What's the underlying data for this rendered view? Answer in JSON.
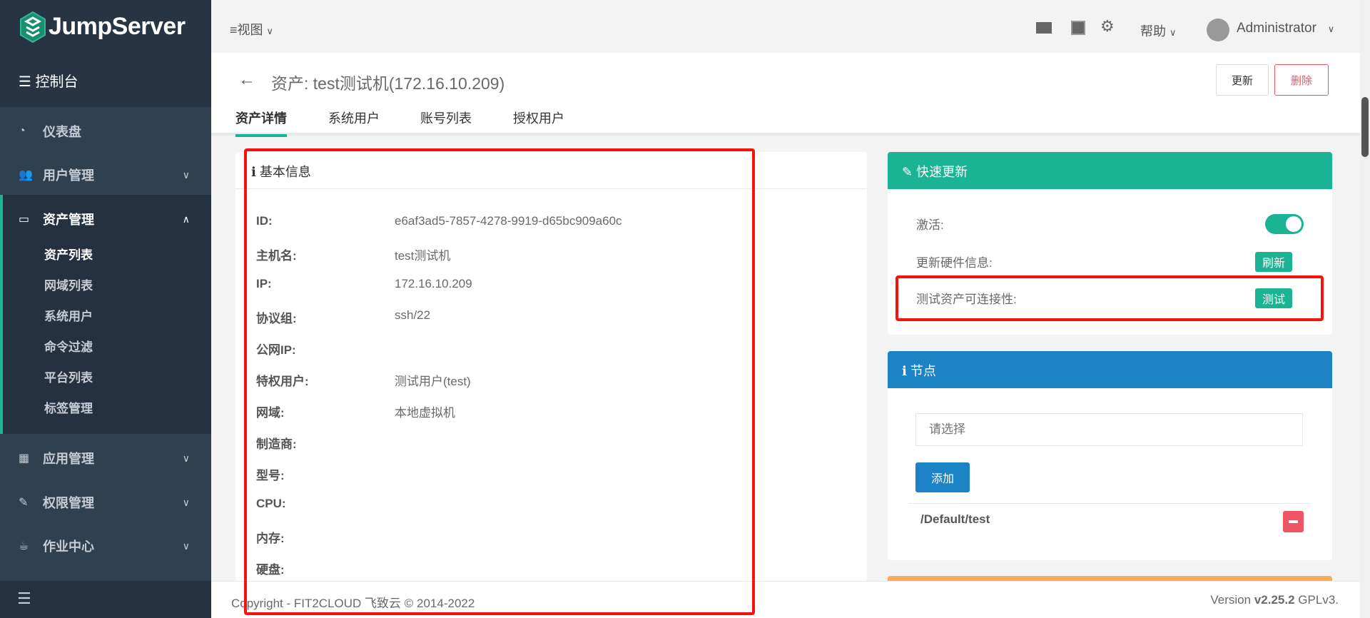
{
  "brand": {
    "name": "JumpServer",
    "console": "控制台"
  },
  "sidebar": {
    "items": [
      {
        "label": "仪表盘",
        "icon": "dashboard-icon"
      },
      {
        "label": "用户管理",
        "icon": "users-icon"
      },
      {
        "label": "资产管理",
        "icon": "inbox-icon"
      },
      {
        "label": "应用管理",
        "icon": "grid-icon"
      },
      {
        "label": "权限管理",
        "icon": "edit-icon"
      },
      {
        "label": "作业中心",
        "icon": "coffee-icon"
      }
    ],
    "sub_items": [
      "资产列表",
      "网域列表",
      "系统用户",
      "命令过滤",
      "平台列表",
      "标签管理"
    ]
  },
  "topbar": {
    "view": "视图",
    "help": "帮助",
    "user": "Administrator"
  },
  "page": {
    "title": "资产: test测试机(172.16.10.209)",
    "update": "更新",
    "delete": "删除",
    "tabs": [
      "资产详情",
      "系统用户",
      "账号列表",
      "授权用户"
    ]
  },
  "basic": {
    "title": "基本信息",
    "rows": [
      {
        "label": "ID:",
        "value": "e6af3ad5-7857-4278-9919-d65bc909a60c"
      },
      {
        "label": "主机名:",
        "value": "test测试机"
      },
      {
        "label": "IP:",
        "value": "172.16.10.209"
      },
      {
        "label": "协议组:",
        "value": "ssh/22"
      },
      {
        "label": "公网IP:",
        "value": ""
      },
      {
        "label": "特权用户:",
        "value": "测试用户(test)"
      },
      {
        "label": "网域:",
        "value": "本地虚拟机"
      },
      {
        "label": "制造商:",
        "value": ""
      },
      {
        "label": "型号:",
        "value": ""
      },
      {
        "label": "CPU:",
        "value": ""
      },
      {
        "label": "内存:",
        "value": ""
      },
      {
        "label": "硬盘:",
        "value": ""
      }
    ]
  },
  "quick": {
    "title": "快速更新",
    "active": "激活:",
    "active_on": true,
    "hw": "更新硬件信息:",
    "hw_btn": "刷新",
    "test": "测试资产可连接性:",
    "test_btn": "测试"
  },
  "nodes": {
    "title": "节点",
    "placeholder": "请选择",
    "add": "添加",
    "items": [
      "/Default/test"
    ]
  },
  "footer": {
    "copyright": "Copyright - FIT2CLOUD 飞致云 © 2014-2022",
    "version_prefix": "Version",
    "version": "v2.25.2",
    "license": "GPLv3."
  }
}
